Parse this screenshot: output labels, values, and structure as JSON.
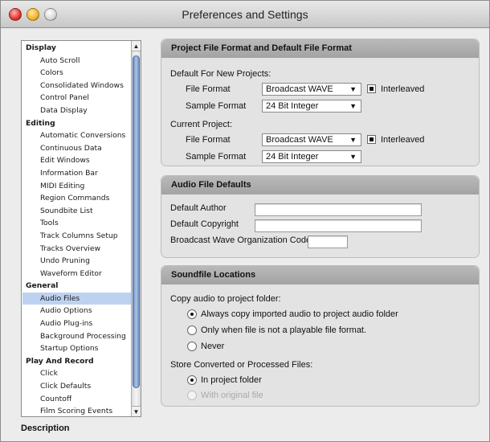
{
  "window": {
    "title": "Preferences and Settings"
  },
  "sidebar": {
    "rows": [
      {
        "label": "Display",
        "type": "group"
      },
      {
        "label": "Auto Scroll",
        "type": "item"
      },
      {
        "label": "Colors",
        "type": "item"
      },
      {
        "label": "Consolidated Windows",
        "type": "item"
      },
      {
        "label": "Control Panel",
        "type": "item"
      },
      {
        "label": "Data Display",
        "type": "item"
      },
      {
        "label": "Editing",
        "type": "group"
      },
      {
        "label": "Automatic Conversions",
        "type": "item"
      },
      {
        "label": "Continuous Data",
        "type": "item"
      },
      {
        "label": "Edit Windows",
        "type": "item"
      },
      {
        "label": "Information Bar",
        "type": "item"
      },
      {
        "label": "MIDI Editing",
        "type": "item"
      },
      {
        "label": "Region Commands",
        "type": "item"
      },
      {
        "label": "Soundbite List",
        "type": "item"
      },
      {
        "label": "Tools",
        "type": "item"
      },
      {
        "label": "Track Columns Setup",
        "type": "item"
      },
      {
        "label": "Tracks Overview",
        "type": "item"
      },
      {
        "label": "Undo Pruning",
        "type": "item"
      },
      {
        "label": "Waveform Editor",
        "type": "item"
      },
      {
        "label": "General",
        "type": "group"
      },
      {
        "label": "Audio Files",
        "type": "item",
        "selected": true
      },
      {
        "label": "Audio Options",
        "type": "item"
      },
      {
        "label": "Audio Plug-ins",
        "type": "item"
      },
      {
        "label": "Background Processing",
        "type": "item"
      },
      {
        "label": "Startup Options",
        "type": "item"
      },
      {
        "label": "Play And Record",
        "type": "group"
      },
      {
        "label": "Click",
        "type": "item"
      },
      {
        "label": "Click Defaults",
        "type": "item"
      },
      {
        "label": "Countoff",
        "type": "item"
      },
      {
        "label": "Film Scoring Events",
        "type": "item"
      }
    ],
    "scroll_up_glyph": "▲",
    "scroll_down_glyph": "▼",
    "selection_color": "#bdd2f0"
  },
  "description_label": "Description",
  "file_format_panel": {
    "title": "Project File Format and Default File Format",
    "new_projects_label": "Default For New Projects:",
    "new_file_format_label": "File Format",
    "new_file_format_value": "Broadcast WAVE",
    "new_interleaved_label": "Interleaved",
    "new_interleaved_checked": true,
    "new_sample_format_label": "Sample Format",
    "new_sample_format_value": "24 Bit Integer",
    "current_project_label": "Current Project:",
    "cur_file_format_label": "File Format",
    "cur_file_format_value": "Broadcast WAVE",
    "cur_interleaved_label": "Interleaved",
    "cur_interleaved_checked": true,
    "cur_sample_format_label": "Sample Format",
    "cur_sample_format_value": "24 Bit Integer",
    "dropdown_glyph": "▼"
  },
  "audio_defaults_panel": {
    "title": "Audio File Defaults",
    "author_label": "Default Author",
    "author_value": "",
    "copyright_label": "Default Copyright",
    "copyright_value": "",
    "org_code_label": "Broadcast Wave Organization Code",
    "org_code_value": ""
  },
  "soundfile_panel": {
    "title": "Soundfile Locations",
    "copy_label": "Copy audio to project folder:",
    "copy_options": [
      {
        "label": "Always copy imported audio to project audio folder",
        "selected": true
      },
      {
        "label": "Only when file is not a playable file format.",
        "selected": false
      },
      {
        "label": "Never",
        "selected": false
      }
    ],
    "store_label": "Store Converted or Processed Files:",
    "store_options": [
      {
        "label": "In project folder",
        "selected": true,
        "disabled": false
      },
      {
        "label": "With original file",
        "selected": false,
        "disabled": true
      }
    ]
  }
}
